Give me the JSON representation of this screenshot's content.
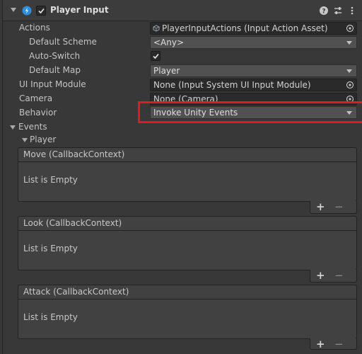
{
  "component": {
    "title": "Player Input",
    "enabled": true,
    "icons": [
      "help-icon",
      "preset-icon",
      "more-options-icon"
    ]
  },
  "properties": {
    "actions": {
      "label": "Actions",
      "value": "PlayerInputActions (Input Action Asset)"
    },
    "default_scheme": {
      "label": "Default Scheme",
      "value": "<Any>"
    },
    "auto_switch": {
      "label": "Auto-Switch",
      "checked": true
    },
    "default_map": {
      "label": "Default Map",
      "value": "Player"
    },
    "ui_input_module": {
      "label": "UI Input Module",
      "value": "None (Input System UI Input Module)"
    },
    "camera": {
      "label": "Camera",
      "value": "None (Camera)"
    },
    "behavior": {
      "label": "Behavior",
      "value": "Invoke Unity Events"
    }
  },
  "events": {
    "label": "Events",
    "group": "Player",
    "items": [
      {
        "title": "Move (CallbackContext)",
        "body": "List is Empty"
      },
      {
        "title": "Look (CallbackContext)",
        "body": "List is Empty"
      },
      {
        "title": "Attack (CallbackContext)",
        "body": "List is Empty"
      }
    ],
    "add_label": "+",
    "remove_label": "−"
  },
  "colors": {
    "background": "#383838",
    "field": "#2a2a2a",
    "dropdown": "#515151",
    "highlight": "#e01b22",
    "input_icon": "#2f8de0"
  }
}
